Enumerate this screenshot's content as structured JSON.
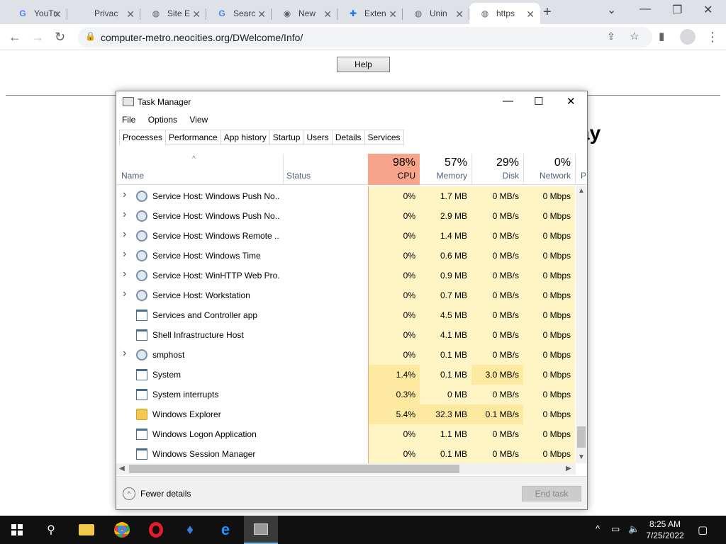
{
  "browser": {
    "tabs": [
      {
        "label": "YouTu",
        "icon": "google-icon"
      },
      {
        "label": "Privacy er",
        "icon": "none"
      },
      {
        "label": "Site E",
        "icon": "globe-icon"
      },
      {
        "label": "Searc",
        "icon": "google-icon"
      },
      {
        "label": "New",
        "icon": "chrome-icon"
      },
      {
        "label": "Exten",
        "icon": "puzzle-icon"
      },
      {
        "label": "Unin",
        "icon": "globe-icon"
      },
      {
        "label": "https",
        "icon": "globe-icon",
        "active": true
      }
    ],
    "url": "computer-metro.neocities.org/DWelcome/Info/"
  },
  "page": {
    "help_label": "Help",
    "bg_text": "ay"
  },
  "taskmanager": {
    "title": "Task Manager",
    "menu": [
      "File",
      "Options",
      "View"
    ],
    "tabs": [
      "Processes",
      "Performance",
      "App history",
      "Startup",
      "Users",
      "Details",
      "Services"
    ],
    "active_tab": "Processes",
    "columns": {
      "name": "Name",
      "status": "Status",
      "cpu": {
        "pct": "98%",
        "label": "CPU"
      },
      "memory": {
        "pct": "57%",
        "label": "Memory"
      },
      "disk": {
        "pct": "29%",
        "label": "Disk"
      },
      "network": {
        "pct": "0%",
        "label": "Network"
      },
      "power_partial": "P"
    },
    "processes": [
      {
        "name": "Service Host: Windows Push No...",
        "expandable": true,
        "icon": "gear-icon",
        "cpu": "0%",
        "mem": "1.7 MB",
        "disk": "0 MB/s",
        "net": "0 Mbps"
      },
      {
        "name": "Service Host: Windows Push No...",
        "expandable": true,
        "icon": "gear-icon",
        "cpu": "0%",
        "mem": "2.9 MB",
        "disk": "0 MB/s",
        "net": "0 Mbps"
      },
      {
        "name": "Service Host: Windows Remote ...",
        "expandable": true,
        "icon": "gear-icon",
        "cpu": "0%",
        "mem": "1.4 MB",
        "disk": "0 MB/s",
        "net": "0 Mbps"
      },
      {
        "name": "Service Host: Windows Time",
        "expandable": true,
        "icon": "gear-icon",
        "cpu": "0%",
        "mem": "0.6 MB",
        "disk": "0 MB/s",
        "net": "0 Mbps"
      },
      {
        "name": "Service Host: WinHTTP Web Pro...",
        "expandable": true,
        "icon": "gear-icon",
        "cpu": "0%",
        "mem": "0.9 MB",
        "disk": "0 MB/s",
        "net": "0 Mbps"
      },
      {
        "name": "Service Host: Workstation",
        "expandable": true,
        "icon": "gear-icon",
        "cpu": "0%",
        "mem": "0.7 MB",
        "disk": "0 MB/s",
        "net": "0 Mbps"
      },
      {
        "name": "Services and Controller app",
        "expandable": false,
        "icon": "window-icon",
        "cpu": "0%",
        "mem": "4.5 MB",
        "disk": "0 MB/s",
        "net": "0 Mbps"
      },
      {
        "name": "Shell Infrastructure Host",
        "expandable": false,
        "icon": "window-icon",
        "cpu": "0%",
        "mem": "4.1 MB",
        "disk": "0 MB/s",
        "net": "0 Mbps"
      },
      {
        "name": "smphost",
        "expandable": true,
        "icon": "gear-icon",
        "cpu": "0%",
        "mem": "0.1 MB",
        "disk": "0 MB/s",
        "net": "0 Mbps"
      },
      {
        "name": "System",
        "expandable": false,
        "icon": "window-icon",
        "cpu": "1.4%",
        "mem": "0.1 MB",
        "disk": "3.0 MB/s",
        "net": "0 Mbps"
      },
      {
        "name": "System interrupts",
        "expandable": false,
        "icon": "window-icon",
        "cpu": "0.3%",
        "mem": "0 MB",
        "disk": "0 MB/s",
        "net": "0 Mbps"
      },
      {
        "name": "Windows Explorer",
        "expandable": false,
        "icon": "folder-icon",
        "cpu": "5.4%",
        "mem": "32.3 MB",
        "disk": "0.1 MB/s",
        "net": "0 Mbps"
      },
      {
        "name": "Windows Logon Application",
        "expandable": false,
        "icon": "window-icon",
        "cpu": "0%",
        "mem": "1.1 MB",
        "disk": "0 MB/s",
        "net": "0 Mbps"
      },
      {
        "name": "Windows Session Manager",
        "expandable": false,
        "icon": "window-icon",
        "cpu": "0%",
        "mem": "0.1 MB",
        "disk": "0 MB/s",
        "net": "0 Mbps"
      }
    ],
    "fewer_details": "Fewer details",
    "end_task": "End task",
    "colors": {
      "cpu_header": "#f7a48a",
      "cell_light": "#fff4c4",
      "cell_mid": "#fdeaa0"
    }
  },
  "taskbar": {
    "time": "8:25 AM",
    "date": "7/25/2022"
  }
}
